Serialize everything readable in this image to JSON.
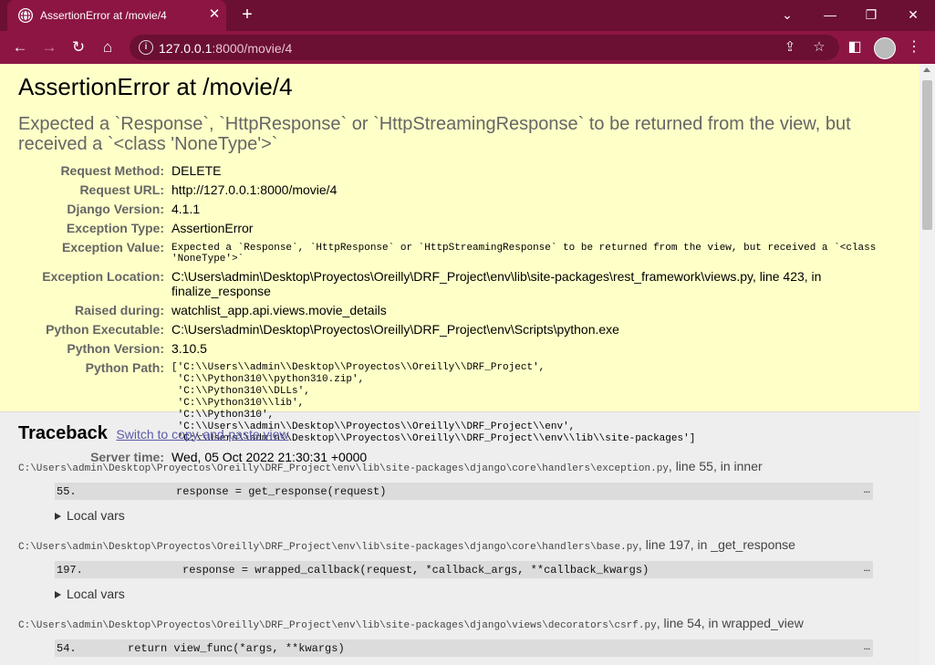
{
  "browser": {
    "tab_title": "AssertionError at /movie/4",
    "url_host": "127.0.0.1",
    "url_path": ":8000/movie/4"
  },
  "page": {
    "title": "AssertionError at /movie/4",
    "exception_value_line1": "Expected a `Response`, `HttpResponse` or `HttpStreamingResponse` to be returned from the view, but",
    "exception_value_line2": "received a `<class 'NoneType'>`",
    "meta": {
      "request_method": {
        "label": "Request Method:",
        "value": "DELETE"
      },
      "request_url": {
        "label": "Request URL:",
        "value": "http://127.0.0.1:8000/movie/4"
      },
      "django_version": {
        "label": "Django Version:",
        "value": "4.1.1"
      },
      "exception_type": {
        "label": "Exception Type:",
        "value": "AssertionError"
      },
      "exception_value": {
        "label": "Exception Value:",
        "value": "Expected a `Response`, `HttpResponse` or `HttpStreamingResponse` to be returned from the view, but received a `<class 'NoneType'>`"
      },
      "exception_location": {
        "label": "Exception Location:",
        "value": "C:\\Users\\admin\\Desktop\\Proyectos\\Oreilly\\DRF_Project\\env\\lib\\site-packages\\rest_framework\\views.py, line 423, in finalize_response"
      },
      "raised_during": {
        "label": "Raised during:",
        "value": "watchlist_app.api.views.movie_details"
      },
      "python_executable": {
        "label": "Python Executable:",
        "value": "C:\\Users\\admin\\Desktop\\Proyectos\\Oreilly\\DRF_Project\\env\\Scripts\\python.exe"
      },
      "python_version": {
        "label": "Python Version:",
        "value": "3.10.5"
      },
      "python_path": {
        "label": "Python Path:",
        "lines": [
          "['C:\\\\Users\\\\admin\\\\Desktop\\\\Proyectos\\\\Oreilly\\\\DRF_Project',",
          " 'C:\\\\Python310\\\\python310.zip',",
          " 'C:\\\\Python310\\\\DLLs',",
          " 'C:\\\\Python310\\\\lib',",
          " 'C:\\\\Python310',",
          " 'C:\\\\Users\\\\admin\\\\Desktop\\\\Proyectos\\\\Oreilly\\\\DRF_Project\\\\env',",
          " 'C:\\\\Users\\\\admin\\\\Desktop\\\\Proyectos\\\\Oreilly\\\\DRF_Project\\\\env\\\\lib\\\\site-packages']"
        ]
      },
      "server_time": {
        "label": "Server time:",
        "value": "Wed, 05 Oct 2022 21:30:31 +0000"
      }
    },
    "traceback": {
      "heading": "Traceback",
      "switch_link": "Switch to copy-and-paste view",
      "local_vars_label": "Local vars",
      "frames": [
        {
          "path": "C:\\Users\\admin\\Desktop\\Proyectos\\Oreilly\\DRF_Project\\env\\lib\\site-packages\\django\\core\\handlers\\exception.py",
          "where": ", line 55, in inner",
          "num": "55.",
          "code": "response = get_response(request)"
        },
        {
          "path": "C:\\Users\\admin\\Desktop\\Proyectos\\Oreilly\\DRF_Project\\env\\lib\\site-packages\\django\\core\\handlers\\base.py",
          "where": ", line 197, in _get_response",
          "num": "197.",
          "code": "response = wrapped_callback(request, *callback_args, **callback_kwargs)"
        },
        {
          "path": "C:\\Users\\admin\\Desktop\\Proyectos\\Oreilly\\DRF_Project\\env\\lib\\site-packages\\django\\views\\decorators\\csrf.py",
          "where": ", line 54, in wrapped_view",
          "num": "54.",
          "code": "return view_func(*args, **kwargs)"
        }
      ],
      "ellipsis": "…"
    }
  }
}
